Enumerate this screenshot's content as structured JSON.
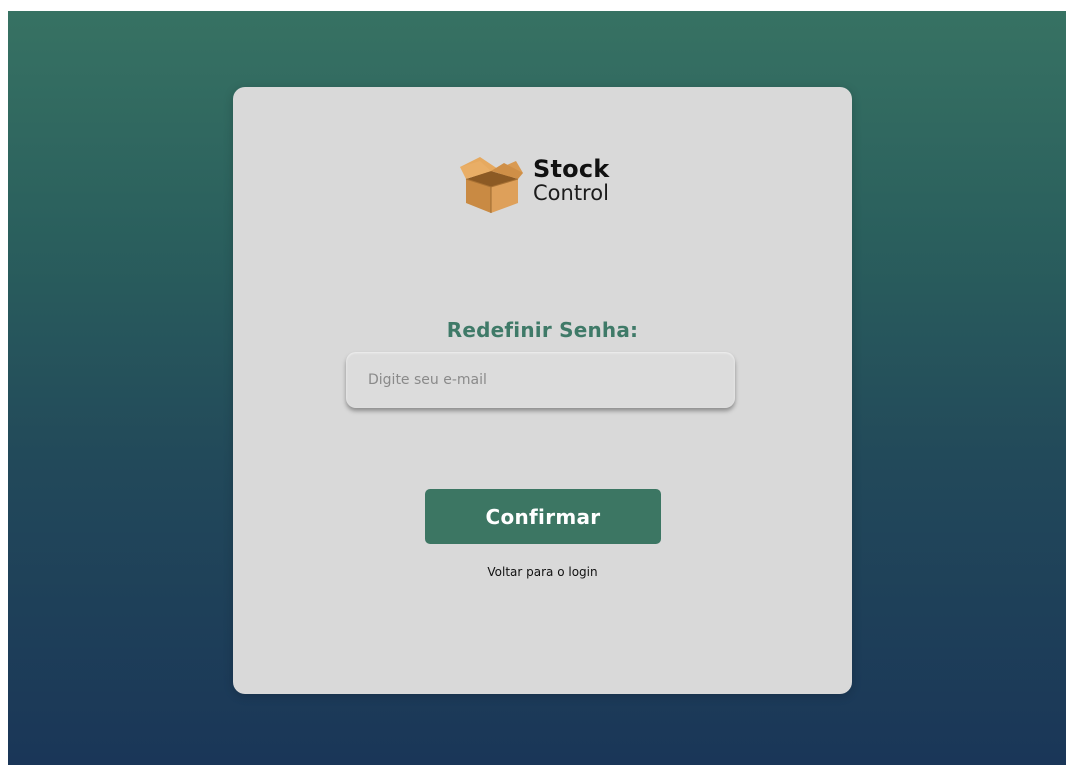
{
  "logo": {
    "line1": "Stock",
    "line2": "Control",
    "icon": "cardboard-box-icon",
    "colors": {
      "box_light": "#e0a257",
      "box_mid": "#c98a43",
      "box_dark": "#a46c2e"
    }
  },
  "form": {
    "title": "Redefinir Senha:",
    "email_placeholder": "Digite seu e-mail",
    "email_value": "",
    "confirm_label": "Confirmar",
    "back_link_label": "Voltar para o login"
  },
  "colors": {
    "accent": "#3c7663",
    "title": "#3f7a68",
    "card": "#d9d9d9",
    "background_top": "#377263",
    "background_bottom": "#1a3658"
  }
}
